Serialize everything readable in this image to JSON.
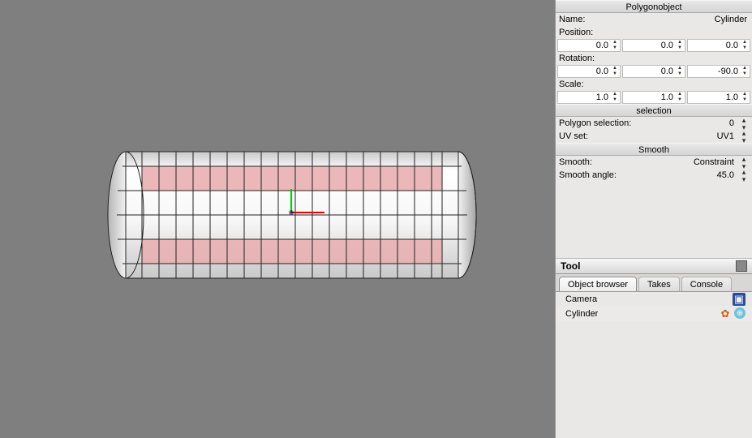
{
  "properties": {
    "header": "Polygonobject",
    "name_label": "Name:",
    "name_value": "Cylinder",
    "position_label": "Position:",
    "position": {
      "x": "0.0",
      "y": "0.0",
      "z": "0.0"
    },
    "rotation_label": "Rotation:",
    "rotation": {
      "x": "0.0",
      "y": "0.0",
      "z": "-90.0"
    },
    "scale_label": "Scale:",
    "scale": {
      "x": "1.0",
      "y": "1.0",
      "z": "1.0"
    }
  },
  "selection": {
    "header": "selection",
    "poly_label": "Polygon selection:",
    "poly_value": "0",
    "uv_label": "UV set:",
    "uv_value": "UV1"
  },
  "smooth": {
    "header": "Smooth",
    "smooth_label": "Smooth:",
    "smooth_value": "Constraint",
    "angle_label": "Smooth angle:",
    "angle_value": "45.0"
  },
  "tool": {
    "title": "Tool",
    "icon": "chart-icon"
  },
  "tabs": {
    "browser": "Object browser",
    "takes": "Takes",
    "console": "Console",
    "active": "browser"
  },
  "objects": [
    {
      "name": "Camera",
      "icons": [
        "camera"
      ]
    },
    {
      "name": "Cylinder",
      "icons": [
        "star",
        "globe"
      ]
    }
  ]
}
